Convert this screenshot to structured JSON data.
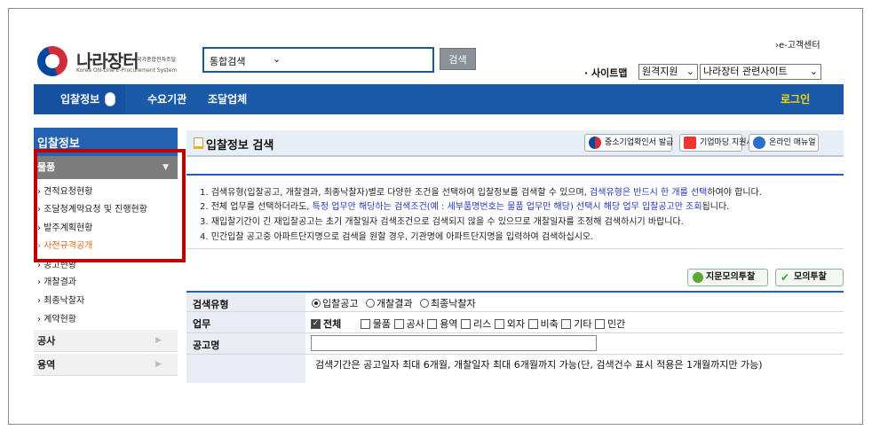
{
  "header": {
    "logo_title": "나라장터",
    "logo_small": "국가종합전자조달",
    "logo_sub": "Korea ON-Line E-Procurement System",
    "search_type": "통합검색",
    "search_button": "검색",
    "ecenter": "›e-고객센터",
    "sitemap": "· 사이트맵",
    "remote_support": "원격지원",
    "related_sites": "나라장터 관련사이트"
  },
  "nav": {
    "bid_info": "입찰정보",
    "demand_inst": "수요기관",
    "supplier": "조달업체",
    "login": "로그인"
  },
  "sidebar": {
    "title": "입찰정보",
    "goods": "물품",
    "goods_items": [
      {
        "label": "› 견적요청현황"
      },
      {
        "label": "› 조달청계약요청 및 진행현황"
      },
      {
        "label": "› 발주계획현황"
      },
      {
        "label": "› 사전규격공개"
      },
      {
        "label": "› 공고현황"
      },
      {
        "label": "› 개찰결과"
      },
      {
        "label": "› 최종낙찰자"
      },
      {
        "label": "› 계약현황"
      }
    ],
    "cat_construction": "공사",
    "cat_service": "용역"
  },
  "content": {
    "title": "입찰정보 검색",
    "btn_sme": "중소기업확인서 발급",
    "btn_support": "기업마당 지원사업",
    "btn_manual": "온라인 매뉴얼",
    "notices": {
      "n1a": "1. 검색유형(입찰공고, 개찰결과, 최종낙찰자)별로 다양한 조건을 선택하여 입찰정보를 검색할 수 있으며, ",
      "n1b": "검색유형은 반드시 한 개를 선택",
      "n1c": "하여야 합니다.",
      "n2a": "2. 전체 업무를 선택하더라도, ",
      "n2b": "특정 업무만 해당하는 검색조건(예 : 세부품명번호는 물품 업무만 해당) 선택시 해당 업무 입찰공고만 조회",
      "n2c": "됩니다.",
      "n3": "3. 재입찰기간이 긴 재입찰공고는 초기 개찰일자 검색조건으로 검색되지 않을 수 있으므로 개찰일자를 조정해 검색하시기 바랍니다.",
      "n4": "4. 민간입찰 공고중 아파트단지명으로 검색을 원할 경우, 기관명에 아파트단지명을 입력하여 검색하십시오."
    },
    "btn_mock": "지문모의투찰",
    "btn_mockbid": "모의투찰",
    "form": {
      "search_type_label": "검색유형",
      "search_types": [
        "입찰공고",
        "개찰결과",
        "최종낙찰자"
      ],
      "task_label": "업무",
      "tasks": [
        "전체",
        "물품",
        "공사",
        "용역",
        "리스",
        "외자",
        "비축",
        "기타",
        "민간"
      ],
      "notice_name_label": "공고명",
      "notice_name_value": "",
      "period_note": "검색기간은 공고일자 최대 6개월, 개찰일자 최대 6개월까지 가능(단, 검색건수 표시 적용은 1개월까지만 가능)"
    }
  }
}
